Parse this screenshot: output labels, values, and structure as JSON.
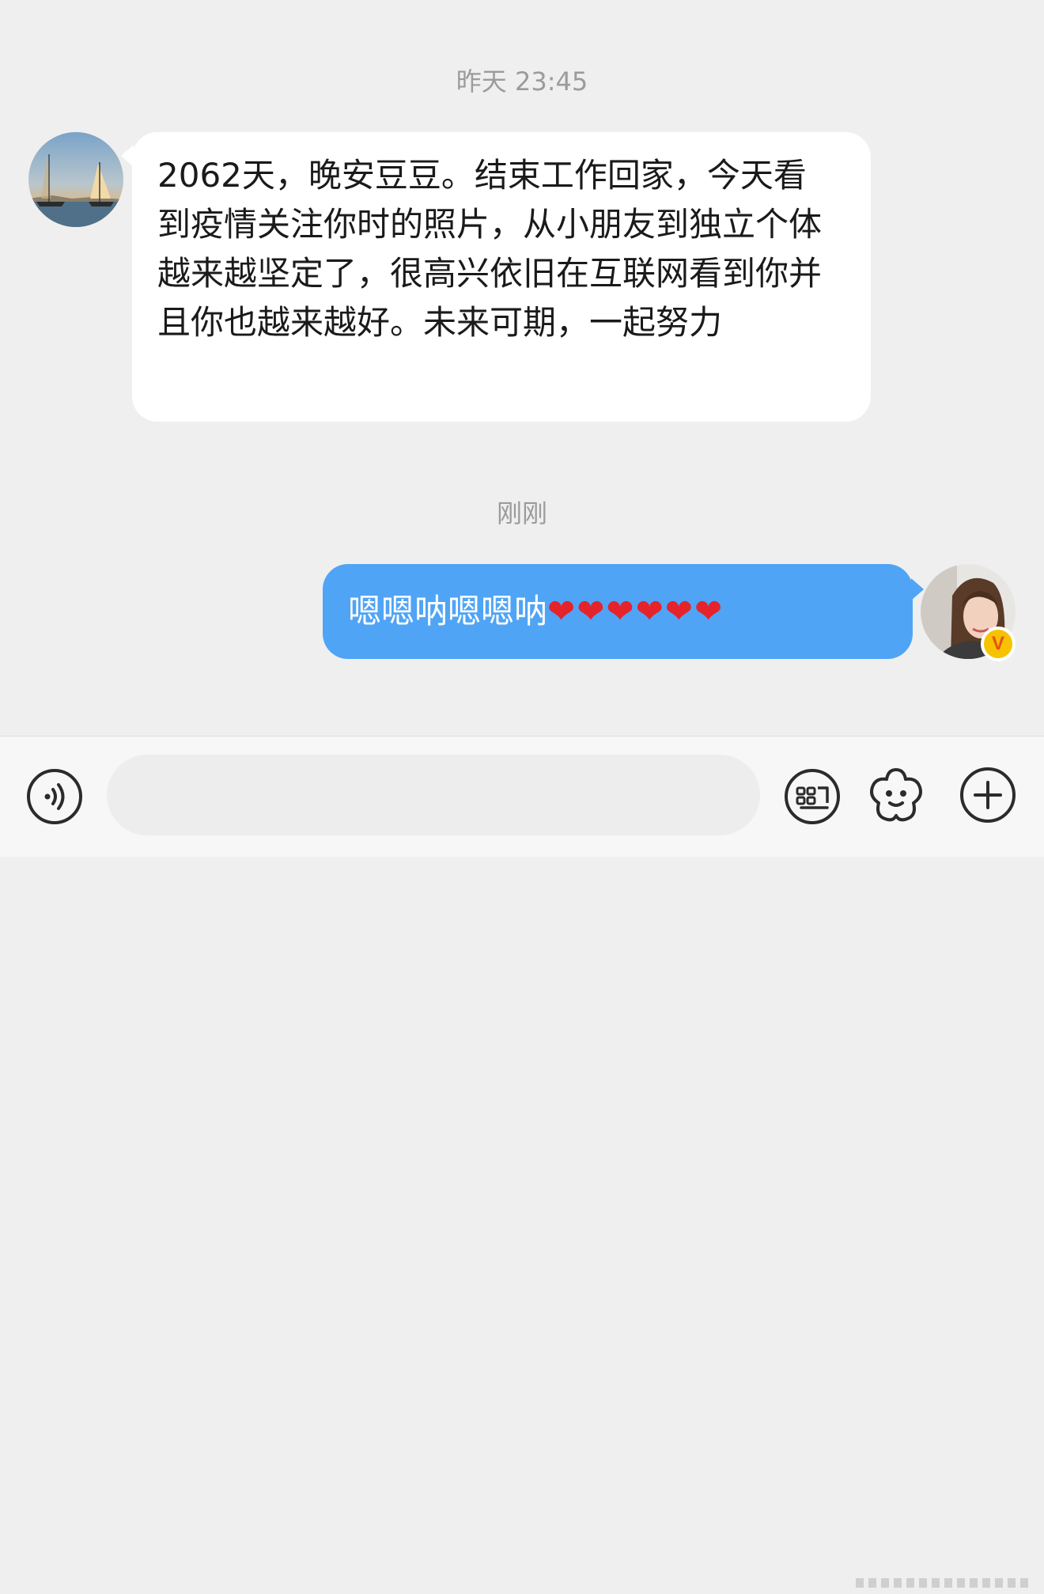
{
  "chat": {
    "timestamp_1": "昨天 23:45",
    "timestamp_2": "刚刚",
    "incoming_message": "2062天，晚安豆豆。结束工作回家，今天看到疫情关注你时的照片，从小朋友到独立个体越来越坚定了，很高兴依旧在互联网看到你并且你也越来越好。未来可期，一起努力",
    "outgoing_message_text": "嗯嗯呐嗯嗯呐",
    "outgoing_message_hearts": "❤❤❤❤❤❤",
    "verified_badge": "V"
  },
  "input_bar": {
    "text_value": "",
    "text_placeholder": "",
    "voice_icon": "voice-wave-icon",
    "keyboard_icon": "keyboard-icon",
    "emoji_icon": "emoji-face-icon",
    "plus_icon": "plus-icon"
  },
  "colors": {
    "background": "#efefef",
    "outgoing_bubble": "#4fa4f6",
    "incoming_bubble": "#ffffff",
    "heart": "#e4232b",
    "verified": "#f7c200"
  }
}
